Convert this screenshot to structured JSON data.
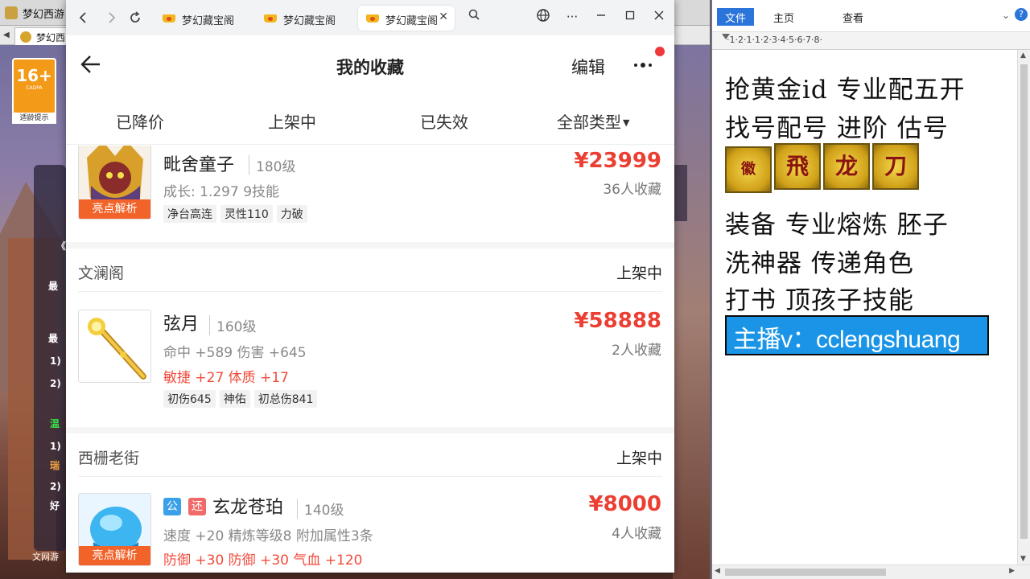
{
  "game_window": {
    "title": "梦幻西游",
    "tab_label": "梦幻西",
    "age_rating": {
      "number": "16+",
      "org": "CADPA",
      "tip": "适龄提示"
    },
    "panel_texts": [
      "《",
      "最",
      "最",
      "1)",
      "2)",
      "温",
      "1)",
      "瑞",
      "2)",
      "好"
    ],
    "bottom_text": "文网游"
  },
  "browser": {
    "tabs": [
      {
        "label": "梦幻藏宝阁",
        "active": false
      },
      {
        "label": "梦幻藏宝阁",
        "active": false
      },
      {
        "label": "梦幻藏宝阁",
        "active": true
      }
    ],
    "icons": {
      "back": "chevron-left-icon",
      "forward": "chevron-right-icon",
      "reload": "reload-icon",
      "search": "search-icon",
      "globe": "globe-icon",
      "more": "ellipsis-icon",
      "minimize": "minimize-icon",
      "maximize": "maximize-icon",
      "close": "close-icon"
    }
  },
  "app": {
    "title": "我的收藏",
    "edit_label": "编辑",
    "filters": [
      "已降价",
      "上架中",
      "已失效",
      "全部类型"
    ],
    "accent_price_color": "#ec3f33",
    "thumb_tag_color": "#f2632a"
  },
  "items": [
    {
      "shop": "",
      "status": "",
      "name": "毗舍童子",
      "level": "180级",
      "lines": [
        {
          "text": "成长: 1.297 9技能",
          "red": false
        }
      ],
      "chips": [
        "净台高连",
        "灵性110",
        "力破"
      ],
      "price": "¥23999",
      "favorites": "36人收藏",
      "thumb_tag": "亮点解析",
      "badges": []
    },
    {
      "shop": "文澜阁",
      "status": "上架中",
      "name": "弦月",
      "level": "160级",
      "lines": [
        {
          "text": "命中 +589 伤害 +645",
          "red": false
        },
        {
          "text": "敏捷 +27 体质 +17",
          "red": true
        }
      ],
      "chips": [
        "初伤645",
        "神佑",
        "初总伤841"
      ],
      "price": "¥58888",
      "favorites": "2人收藏",
      "thumb_tag": "",
      "badges": []
    },
    {
      "shop": "西栅老街",
      "status": "上架中",
      "name": "玄龙苍珀",
      "level": "140级",
      "lines": [
        {
          "text": "速度 +20 精炼等级8 附加属性3条",
          "red": false
        },
        {
          "text": "防御 +30 防御 +30 气血 +120",
          "red": true
        }
      ],
      "chips": [],
      "price": "¥8000",
      "favorites": "4人收藏",
      "thumb_tag": "亮点解析",
      "badges": [
        {
          "text": "公",
          "color": "#3aa0e8"
        },
        {
          "text": "还",
          "color": "#f06a6a"
        }
      ]
    }
  ],
  "word": {
    "ribbon_tabs": [
      "文件",
      "主页",
      "查看"
    ],
    "ruler": "·1·2·1·1·2·3·4·5·6·7·8·",
    "lines": [
      "抢黄金id 专业配五开",
      "找号配号 进阶 估号",
      "装备 专业熔炼 胚子",
      "洗神器 传递角色",
      "打书 顶孩子技能"
    ],
    "seals": [
      "徽",
      "飛",
      "龙",
      "刀"
    ],
    "streamer": "主播v：cclengshuang"
  }
}
